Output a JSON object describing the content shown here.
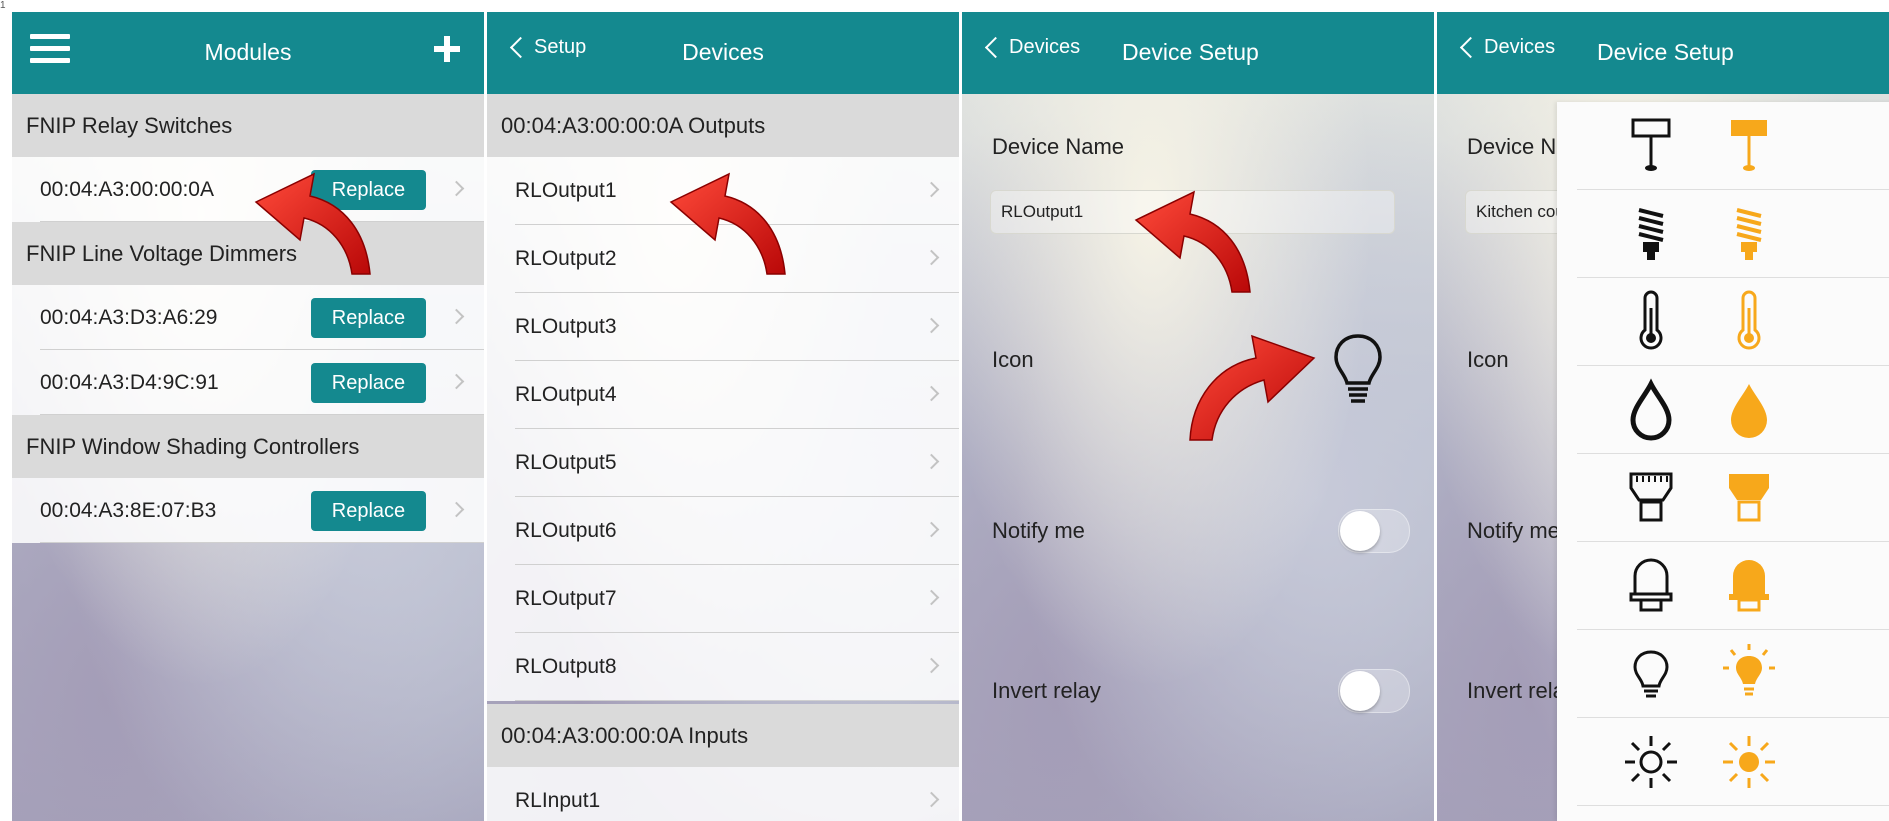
{
  "page_mark": "1",
  "screen1": {
    "title": "Modules",
    "sections": [
      {
        "title": "FNIP Relay Switches"
      },
      {
        "title": "FNIP Line Voltage Dimmers"
      },
      {
        "title": "FNIP Window Shading Controllers"
      }
    ],
    "devices": [
      {
        "mac": "00:04:A3:00:00:0A",
        "button": "Replace"
      },
      {
        "mac": "00:04:A3:D3:A6:29",
        "button": "Replace"
      },
      {
        "mac": "00:04:A3:D4:9C:91",
        "button": "Replace"
      },
      {
        "mac": "00:04:A3:8E:07:B3",
        "button": "Replace"
      }
    ]
  },
  "screen2": {
    "back": "Setup",
    "title": "Devices",
    "outputs_header": "00:04:A3:00:00:0A Outputs",
    "outputs": [
      "RLOutput1",
      "RLOutput2",
      "RLOutput3",
      "RLOutput4",
      "RLOutput5",
      "RLOutput6",
      "RLOutput7",
      "RLOutput8"
    ],
    "inputs_header": "00:04:A3:00:00:0A Inputs",
    "inputs": [
      "RLInput1"
    ]
  },
  "screen3": {
    "back": "Devices",
    "title": "Device Setup",
    "device_name_label": "Device Name",
    "device_name_value": "RLOutput1",
    "icon_label": "Icon",
    "notify_label": "Notify me",
    "invert_label": "Invert relay",
    "notify_on": false,
    "invert_on": false
  },
  "screen4": {
    "back": "Devices",
    "title": "Device Setup",
    "device_name_label": "Device Nar",
    "device_name_value": "Kitchen cou",
    "icon_label": "Icon",
    "notify_label": "Notify me",
    "invert_label": "Invert relay",
    "icon_rows": [
      "pendant-lamp",
      "cfl-bulb",
      "thermometer",
      "water-drop",
      "led-spot",
      "rounded-bulb",
      "light-bulb",
      "sun"
    ]
  },
  "colors": {
    "accent": "#14898f",
    "highlight": "#f7a81b",
    "arrow": "#e01010",
    "section_bg": "#dadada"
  }
}
